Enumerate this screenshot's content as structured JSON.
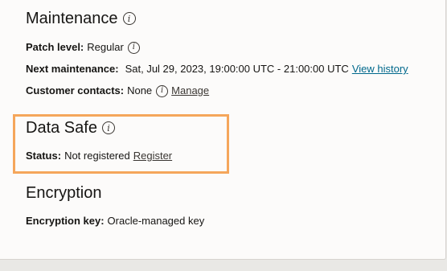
{
  "maintenance": {
    "title": "Maintenance",
    "patch_level_label": "Patch level:",
    "patch_level_value": "Regular",
    "next_maintenance_label": "Next maintenance:",
    "next_maintenance_value": "Sat, Jul 29, 2023, 19:00:00 UTC - 21:00:00 UTC",
    "view_history_link": "View history",
    "customer_contacts_label": "Customer contacts:",
    "customer_contacts_value": "None",
    "manage_link": "Manage"
  },
  "data_safe": {
    "title": "Data Safe",
    "status_label": "Status:",
    "status_value": "Not registered",
    "register_link": "Register",
    "highlight_color": "#f5a65b"
  },
  "encryption": {
    "title": "Encryption",
    "key_label": "Encryption key:",
    "key_value": "Oracle-managed key"
  },
  "icons": {
    "info": "i"
  },
  "colors": {
    "link": "#00688c",
    "panel_background": "#fcfbfa",
    "page_background": "#e9e8e5"
  }
}
